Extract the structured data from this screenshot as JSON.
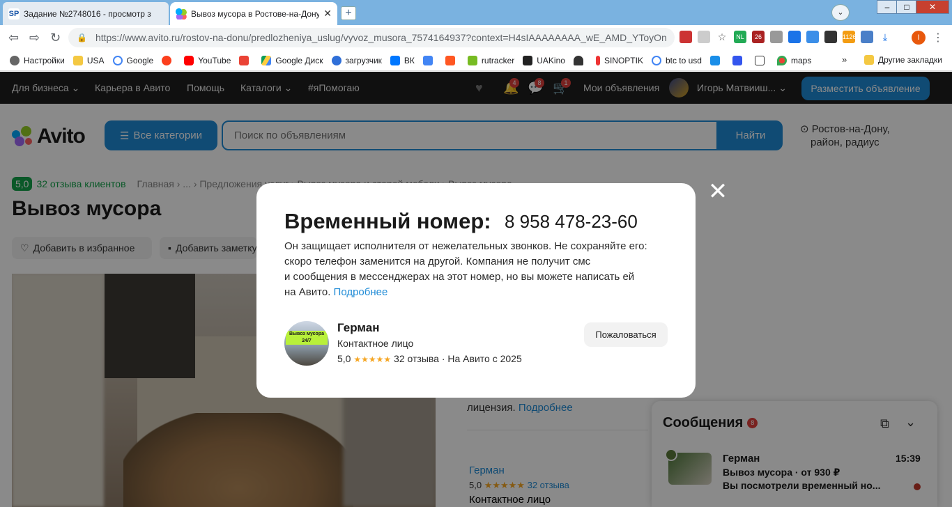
{
  "browser": {
    "tabs": [
      {
        "title": "Задание №2748016 - просмотр з",
        "favicon": "SP",
        "state": "inactive"
      },
      {
        "title": "Вывоз мусора в Ростове-на-Дону",
        "favicon": "avito-icon",
        "state": "active"
      }
    ],
    "url_host": "https://www.avito.ru",
    "url_path": "/rostov-na-donu/predlozheniya_uslug/vyvoz_musora_7574164937?context=H4sIAAAAAAAA_wE_AMD_YToyOn...",
    "bookmarks": [
      "Настройки",
      "USA",
      "Google",
      "",
      "YouTube",
      "",
      "Google Диск",
      "загрузчик",
      "ВК",
      "",
      "",
      "rutracker",
      "UAKino",
      "",
      "SINOPTIK",
      "btc to usd",
      "",
      "",
      "",
      "maps"
    ],
    "bookmarks_more": "»",
    "other_bookmarks": "Другие закладки",
    "ext_badges": {
      "nl": "NL",
      "num26": "26",
      "coin": "1126"
    },
    "profile_letter": "I"
  },
  "site": {
    "top_nav": {
      "for_business": "Для бизнеса",
      "career": "Карьера в Авито",
      "help": "Помощь",
      "catalogs": "Каталоги",
      "ya_help": "#яПомогаю",
      "notif_count": "4",
      "msg_count": "8",
      "cart_count": "1",
      "my_ads": "Мои объявления",
      "user_name": "Игорь Матвииш...",
      "post_button": "Разместить объявление"
    },
    "logo_text": "Avito",
    "all_categories": "Все категории",
    "search_placeholder": "Поиск по объявлениям",
    "find_button": "Найти",
    "location_line1": "Ростов-на-Дону,",
    "location_line2": "район, радиус",
    "rating_score": "5,0",
    "rating_reviews": "32 отзыва клиентов",
    "breadcrumbs": "Главная › ... › Предложения услуг › Вывоз мусора и старой мебели › Вывоз мусора",
    "page_title": "Вывоз мусора",
    "add_favorite": "Добавить в избранное",
    "add_note": "Добавить заметку",
    "description_tail": "лицензия.",
    "description_more": "Подробнее",
    "seller": {
      "name": "Герман",
      "rating": "5,0",
      "stars": "★★★★★",
      "reviews": "32 отзыва",
      "role": "Контактное лицо"
    }
  },
  "messenger": {
    "title": "Сообщения",
    "badge": "8",
    "item": {
      "name": "Герман",
      "time": "15:39",
      "subject": "Вывоз мусора · от 930 ₽",
      "preview": "Вы посмотрели временный но..."
    }
  },
  "modal": {
    "title": "Временный номер:",
    "number": "8 958 478-23-60",
    "text_lines": [
      "Он защищает исполнителя от нежелательных звонков. Не сохраняйте его:",
      "скоро телефон заменится на другой. Компания не получит смс",
      "и сообщения в мессенджерах на этот номер, но вы можете написать ей",
      "на Авито."
    ],
    "more_link": "Подробнее",
    "avatar_text": "Вывоз мусора 24/7",
    "contact_name": "Герман",
    "contact_role": "Контактное лицо",
    "contact_rating": "5,0",
    "contact_stars": "★★★★★",
    "contact_reviews": "32 отзыва",
    "contact_since": " · На Авито с 2025",
    "report_button": "Пожаловаться",
    "close_glyph": "✕"
  },
  "colors": {
    "avito_blue": "#1f8bd6",
    "avito_green": "#13a34a",
    "badge_red": "#e0403c"
  }
}
